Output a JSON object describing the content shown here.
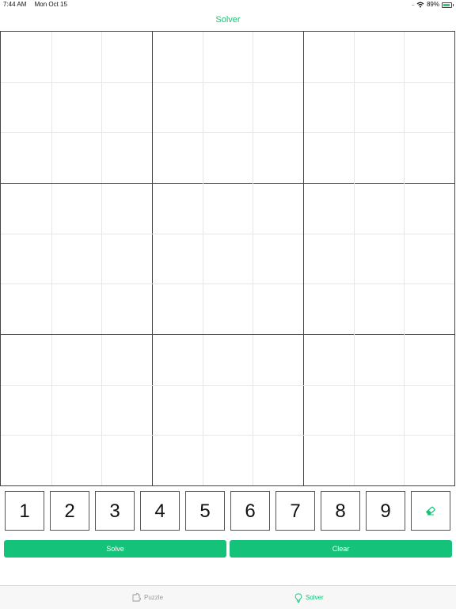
{
  "status_bar": {
    "time": "7:44 AM",
    "date": "Mon Oct 15",
    "signal": ".....",
    "battery": "89%",
    "battery_level": 0.89
  },
  "nav": {
    "title": "Solver"
  },
  "keypad": {
    "keys": [
      "1",
      "2",
      "3",
      "4",
      "5",
      "6",
      "7",
      "8",
      "9"
    ],
    "eraser_icon": "eraser-icon"
  },
  "actions": {
    "solve_label": "Solve",
    "clear_label": "Clear"
  },
  "tabs": [
    {
      "label": "Puzzle",
      "icon": "puzzle-icon",
      "active": false
    },
    {
      "label": "Solver",
      "icon": "lightbulb-icon",
      "active": true
    }
  ],
  "colors": {
    "accent": "#14c27a",
    "inactive": "#9a9a9a"
  }
}
